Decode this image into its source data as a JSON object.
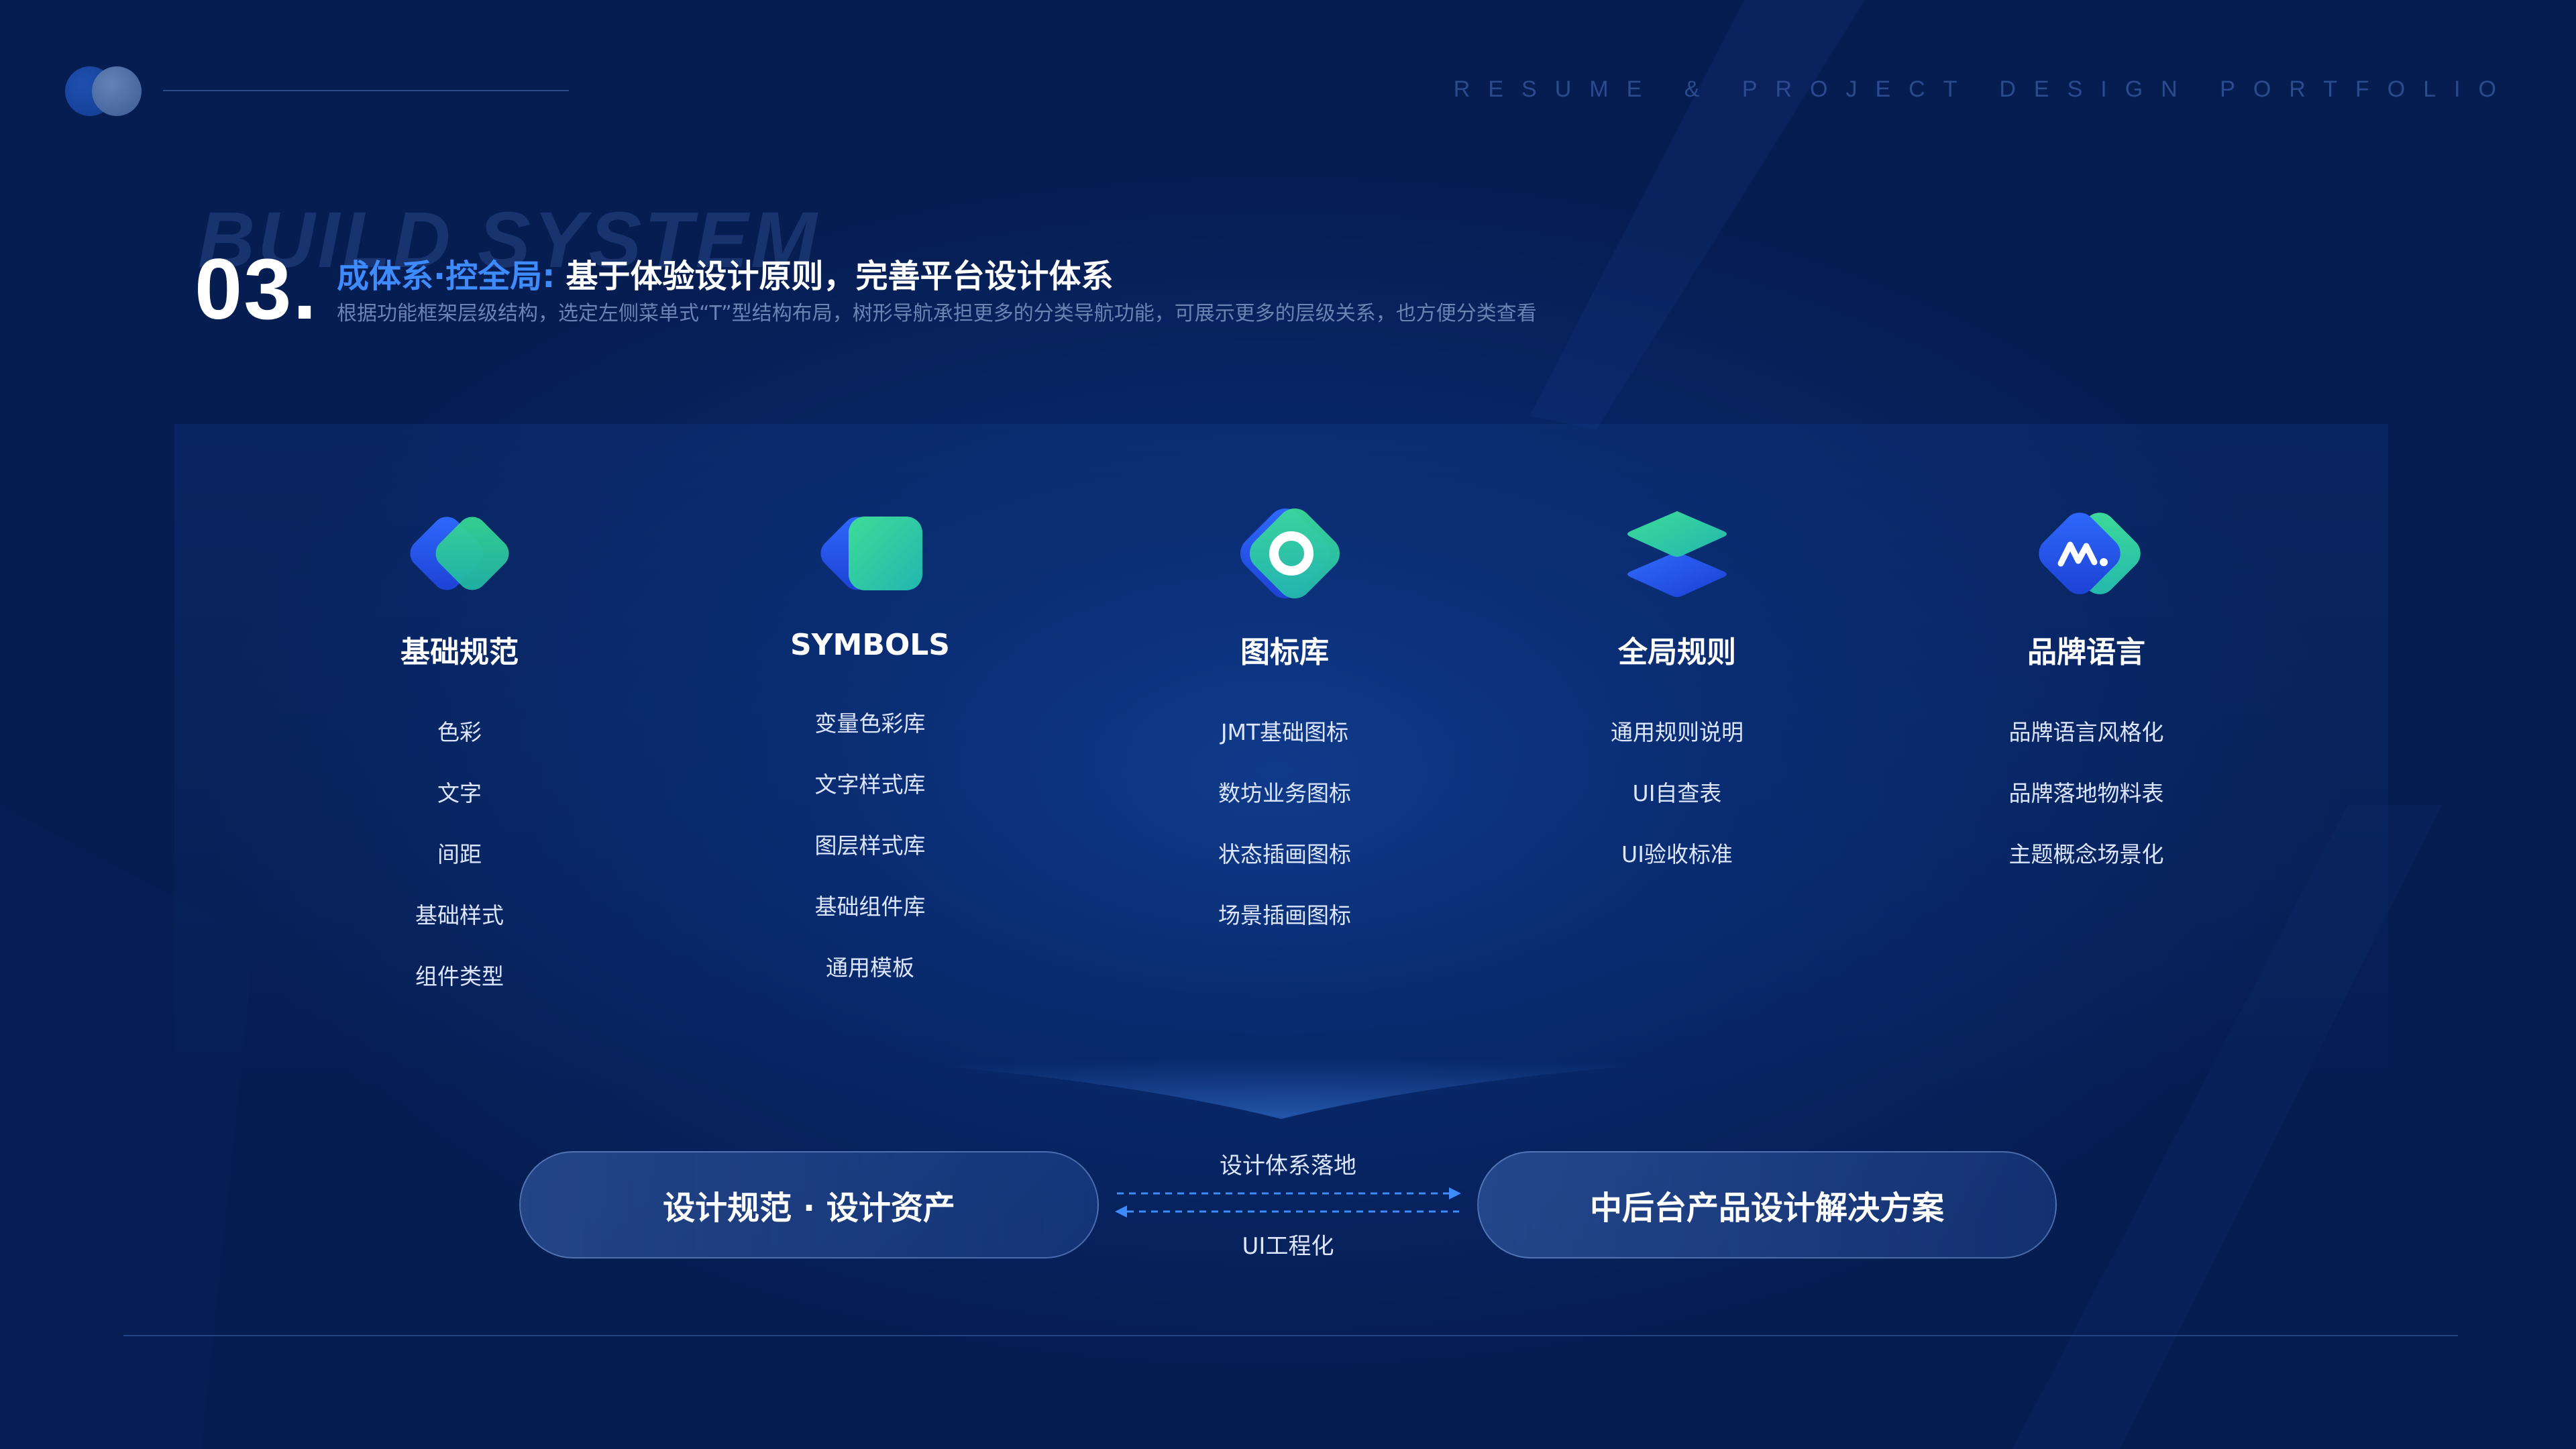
{
  "top": {
    "tag": "RESUME & PROJECT DESIGN PORTFOLIO"
  },
  "header": {
    "ghost": "BUILD SYSTEM",
    "number": "03.",
    "title_accent": "成体系·控全局:",
    "title_main": "基于体验设计原则，完善平台设计体系",
    "description": "根据功能框架层级结构，选定左侧菜单式“T”型结构布局，树形导航承担更多的分类导航功能，可展示更多的层级关系，也方便分类查看"
  },
  "columns": [
    {
      "icon": "diamond-pair-icon",
      "title": "基础规范",
      "items": [
        "色彩",
        "文字",
        "间距",
        "基础样式",
        "组件类型"
      ]
    },
    {
      "icon": "rounded-square-icon",
      "title": "SYMBOLS",
      "items": [
        "变量色彩库",
        "文字样式库",
        "图层样式库",
        "基础组件库",
        "通用模板"
      ]
    },
    {
      "icon": "ring-icon",
      "title": "图标库",
      "items": [
        "JMT基础图标",
        "数坊业务图标",
        "状态插画图标",
        "场景插画图标"
      ]
    },
    {
      "icon": "layers-icon",
      "title": "全局规则",
      "items": [
        "通用规则说明",
        "UI自查表",
        "UI验收标准"
      ]
    },
    {
      "icon": "brand-wave-icon",
      "title": "品牌语言",
      "items": [
        "品牌语言风格化",
        "品牌落地物料表",
        "主题概念场景化"
      ]
    }
  ],
  "bottom": {
    "left_pill": "设计规范 · 设计资产",
    "right_pill": "中后台产品设计解决方案",
    "flow_top": "设计体系落地",
    "flow_bottom": "UI工程化"
  },
  "colors": {
    "accent_blue": "#3d8bff",
    "icon_blue": "#2a55e6",
    "icon_green": "#3ddc97",
    "background": "#082a6e"
  }
}
